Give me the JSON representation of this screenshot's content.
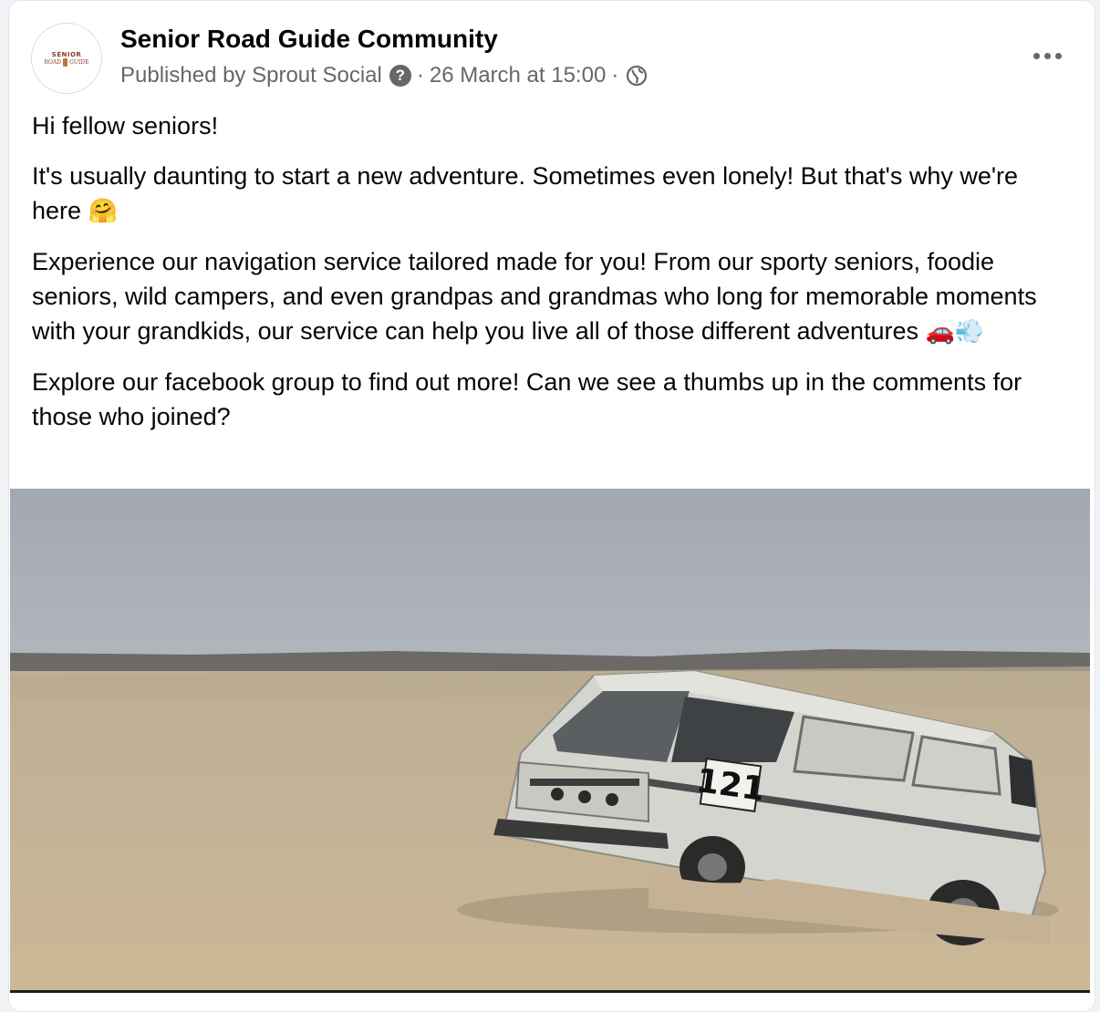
{
  "post": {
    "page_name": "Senior Road Guide Community",
    "published_by": "Published by Sprout Social",
    "timestamp": "26 March at 15:00",
    "separator": "·",
    "more_options_icon": "more-horizontal-icon",
    "help_icon": "question-icon",
    "audience_icon": "globe-icon"
  },
  "avatar": {
    "logo_top": "SENIOR",
    "logo_left": "ROAD",
    "logo_right": "GUIDE"
  },
  "body": {
    "p1": "Hi fellow seniors!",
    "p2": "It's usually daunting to start a new adventure. Sometimes even lonely! But that's why we're here",
    "p2_emoji": "🤗",
    "p3": "Experience our navigation service tailored made for you! From our sporty seniors, foodie seniors, wild campers, and even grandpas and grandmas who long for memorable moments with your grandkids, our service can help you live all of those different adventures",
    "p3_emoji": "🚗💨",
    "p4": "Explore our facebook group to find out more! Can we see a thumbs up in the comments for those who joined?"
  },
  "photo": {
    "van_number": "121"
  },
  "colors": {
    "text_primary": "#050505",
    "text_secondary": "#65676b",
    "sky": "#a7adb6",
    "sand": "#c6b496",
    "van": "#d9d9d4"
  }
}
